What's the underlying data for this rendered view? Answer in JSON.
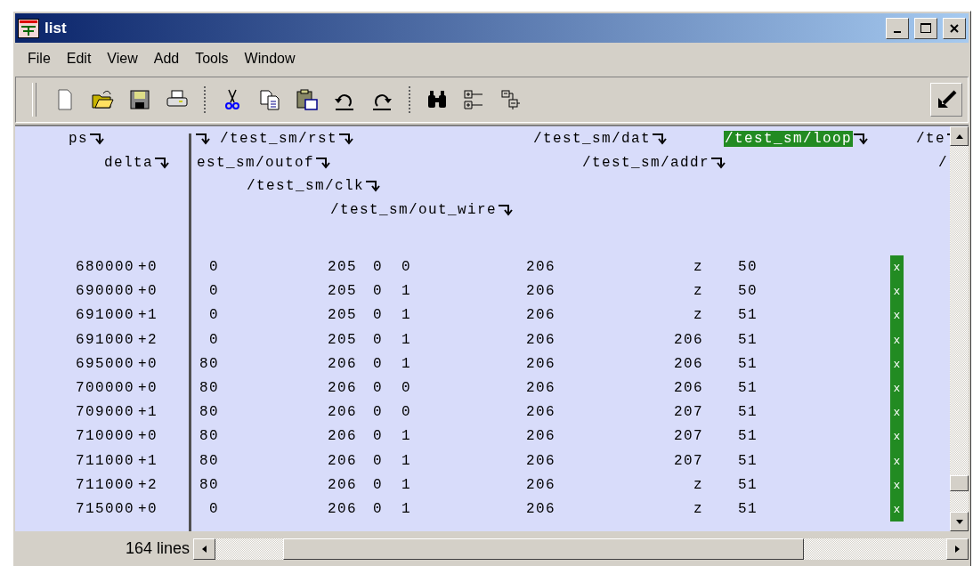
{
  "window": {
    "title": "list"
  },
  "menu": [
    "File",
    "Edit",
    "View",
    "Add",
    "Tools",
    "Window"
  ],
  "left_headers": [
    {
      "label": "ps"
    },
    {
      "label": "delta"
    }
  ],
  "header_lines": [
    [
      {
        "selected": false
      },
      {
        "label": "/test_sm/rst",
        "selected": false
      },
      {
        "label": "/test_sm/dat",
        "selected": false
      },
      {
        "label": "/test_sm/loop",
        "selected": true
      },
      {
        "label": "/te",
        "selected": false
      }
    ],
    [
      {
        "label": "est_sm/outof",
        "selected": false
      },
      {
        "label": "/test_sm/addr",
        "selected": false
      },
      {
        "label": "/",
        "selected": false
      }
    ],
    [
      {
        "label": "/test_sm/clk",
        "selected": false
      }
    ],
    [
      {
        "label": "/test_sm/out_wire",
        "selected": false
      }
    ]
  ],
  "rows": [
    [
      "680000",
      "+0",
      "0",
      "205",
      "0",
      "0",
      "206",
      "z",
      "50",
      "x"
    ],
    [
      "690000",
      "+0",
      "0",
      "205",
      "0",
      "1",
      "206",
      "z",
      "50",
      "x"
    ],
    [
      "691000",
      "+1",
      "0",
      "205",
      "0",
      "1",
      "206",
      "z",
      "51",
      "x"
    ],
    [
      "691000",
      "+2",
      "0",
      "205",
      "0",
      "1",
      "206",
      "206",
      "51",
      "x"
    ],
    [
      "695000",
      "+0",
      "80",
      "206",
      "0",
      "1",
      "206",
      "206",
      "51",
      "x"
    ],
    [
      "700000",
      "+0",
      "80",
      "206",
      "0",
      "0",
      "206",
      "206",
      "51",
      "x"
    ],
    [
      "709000",
      "+1",
      "80",
      "206",
      "0",
      "0",
      "206",
      "207",
      "51",
      "x"
    ],
    [
      "710000",
      "+0",
      "80",
      "206",
      "0",
      "1",
      "206",
      "207",
      "51",
      "x"
    ],
    [
      "711000",
      "+1",
      "80",
      "206",
      "0",
      "1",
      "206",
      "207",
      "51",
      "x"
    ],
    [
      "711000",
      "+2",
      "80",
      "206",
      "0",
      "1",
      "206",
      "z",
      "51",
      "x"
    ],
    [
      "715000",
      "+0",
      "0",
      "206",
      "0",
      "1",
      "206",
      "z",
      "51",
      "x"
    ]
  ],
  "status": "164 lines"
}
